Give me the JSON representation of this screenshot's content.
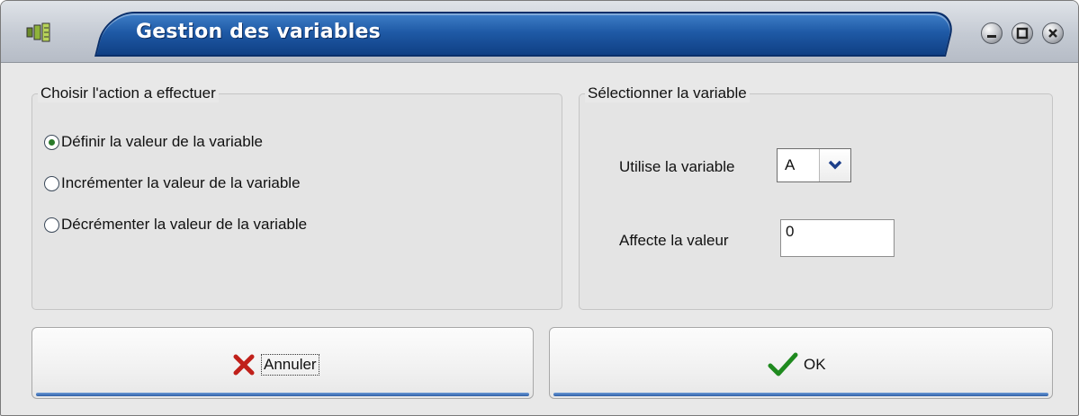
{
  "window": {
    "title": "Gestion des variables",
    "controls": [
      "minimize-icon",
      "maximize-icon",
      "close-icon"
    ]
  },
  "action_group": {
    "legend": "Choisir l'action a effectuer",
    "options": [
      {
        "label": "Définir la valeur de la variable",
        "checked": true
      },
      {
        "label": "Incrémenter la valeur de la variable",
        "checked": false
      },
      {
        "label": "Décrémenter la valeur de la variable",
        "checked": false
      }
    ]
  },
  "variable_group": {
    "legend": "Sélectionner la variable",
    "variable_label": "Utilise la variable",
    "variable_value": "A",
    "value_label": "Affecte la valeur",
    "value_value": "0"
  },
  "buttons": {
    "cancel_label": "Annuler",
    "ok_label": "OK"
  },
  "colors": {
    "title_bar": "#1f5aa6",
    "cancel_icon": "#c0201a",
    "ok_icon": "#1f8a1f",
    "button_underline": "#2e5fa6"
  }
}
